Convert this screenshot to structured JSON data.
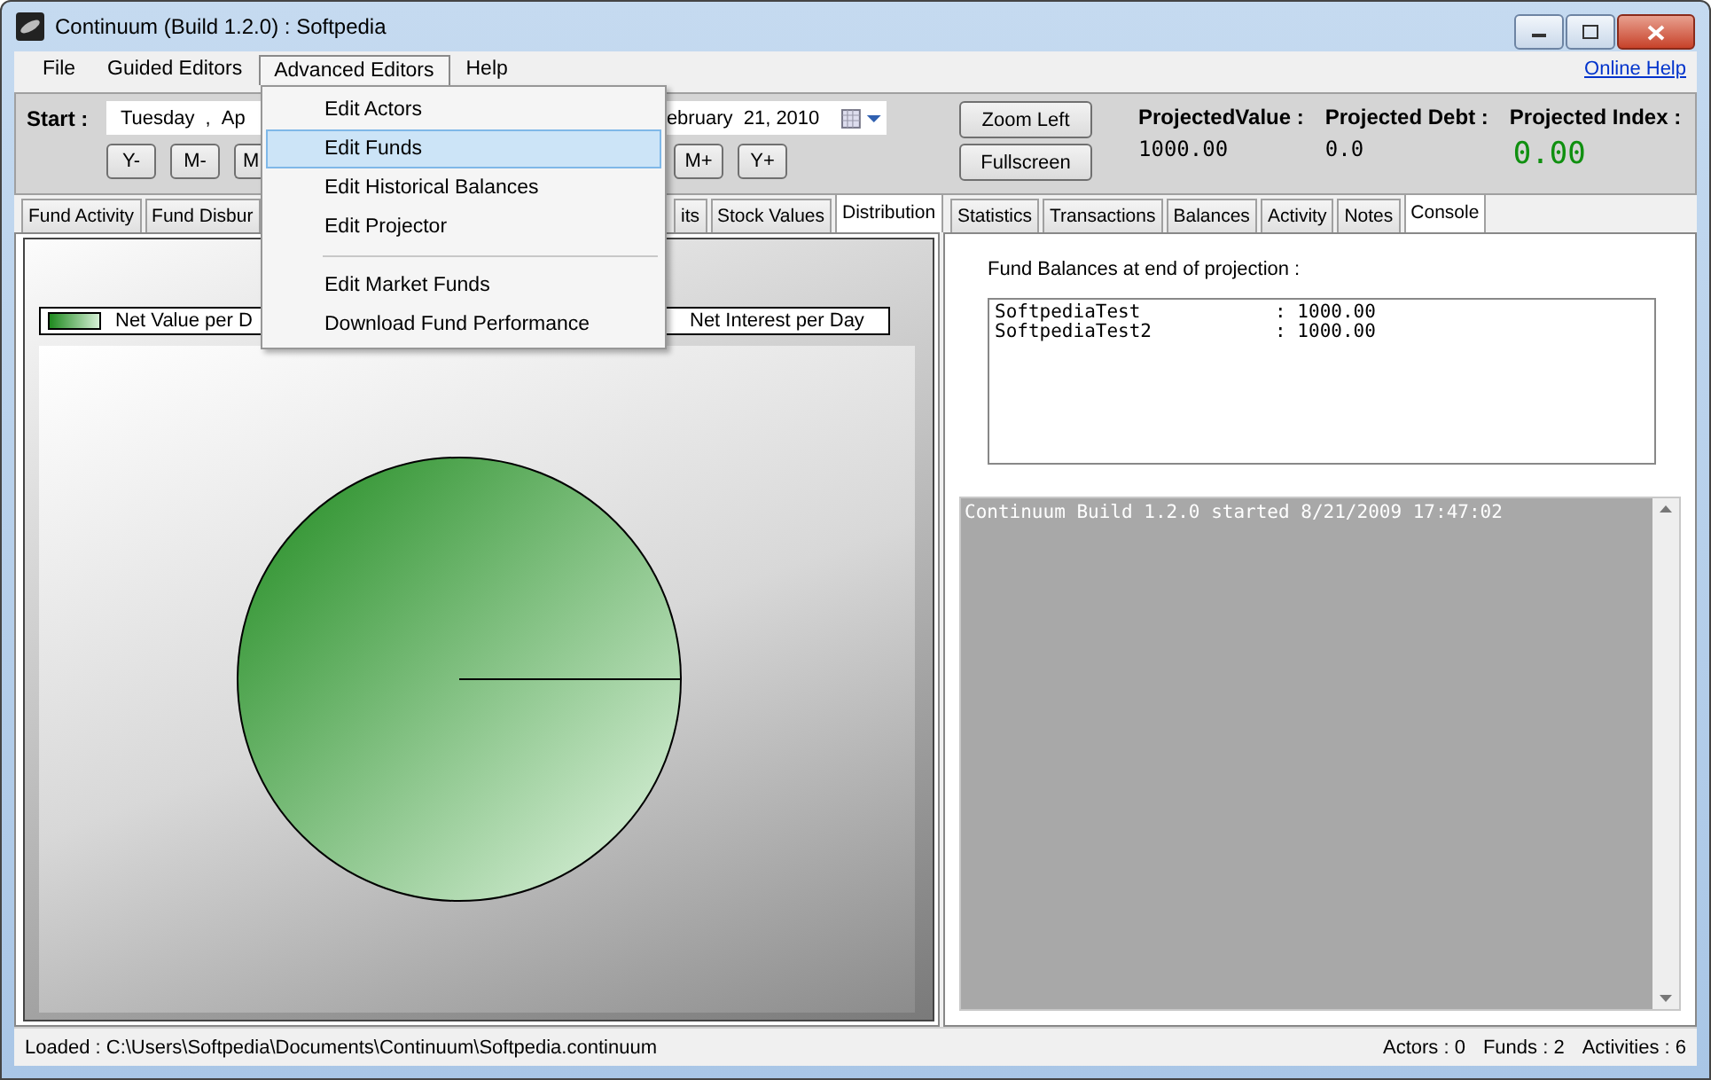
{
  "window": {
    "title": "Continuum (Build 1.2.0) : Softpedia"
  },
  "menu": {
    "items": [
      {
        "label": "File",
        "selected": false
      },
      {
        "label": "Guided Editors",
        "selected": false
      },
      {
        "label": "Advanced Editors",
        "selected": true
      },
      {
        "label": "Help",
        "selected": false
      }
    ],
    "link": "Online Help"
  },
  "dropdown": {
    "items": [
      {
        "kind": "item",
        "label": "Edit Actors",
        "selected": false
      },
      {
        "kind": "item",
        "label": "Edit Funds",
        "selected": true
      },
      {
        "kind": "item",
        "label": "Edit Historical Balances",
        "selected": false
      },
      {
        "kind": "item",
        "label": "Edit Projector",
        "selected": false
      },
      {
        "kind": "separator"
      },
      {
        "kind": "item",
        "label": "Edit Market Funds",
        "selected": false
      },
      {
        "kind": "item",
        "label": "Download Fund Performance",
        "selected": false
      }
    ]
  },
  "toolbar": {
    "start_label": "Start :",
    "date_parts": [
      "Tuesday",
      ",",
      "Ap"
    ],
    "date_end": "ebruary  21, 2010",
    "step_buttons_left": [
      "Y-",
      "M-",
      "M"
    ],
    "step_buttons_right": [
      "M+",
      "Y+"
    ],
    "buttons": [
      "Zoom Left",
      "Fullscreen"
    ],
    "stats": [
      {
        "label": "ProjectedValue :",
        "value": "1000.00",
        "kind": "plain"
      },
      {
        "label": "Projected Debt :",
        "value": "0.0",
        "kind": "plain"
      },
      {
        "label": "Projected Index :",
        "value": "0.00",
        "kind": "highlight"
      }
    ]
  },
  "left_panel": {
    "tabs_left": [
      {
        "label": "Fund Activity",
        "selected": false
      },
      {
        "label": "Fund Disbur",
        "selected": false
      }
    ],
    "tabs_right": [
      {
        "label": "its",
        "selected": false
      },
      {
        "label": "Stock Values",
        "selected": false
      },
      {
        "label": "Distribution",
        "selected": true
      }
    ],
    "legend": [
      "Net Value per D",
      "Net Interest per Day"
    ]
  },
  "right_panel": {
    "tabs": [
      {
        "label": "Statistics",
        "selected": false
      },
      {
        "label": "Transactions",
        "selected": false
      },
      {
        "label": "Balances",
        "selected": false
      },
      {
        "label": "Activity",
        "selected": false
      },
      {
        "label": "Notes",
        "selected": false
      },
      {
        "label": "Console",
        "selected": true
      }
    ],
    "balances_label": "Fund Balances at end of projection :",
    "balances": [
      "SoftpediaTest            : 1000.00",
      "SoftpediaTest2           : 1000.00"
    ],
    "console": [
      "Continuum Build 1.2.0 started 8/21/2009 17:47:02"
    ]
  },
  "status_bar": {
    "path": "Loaded : C:\\Users\\Softpedia\\Documents\\Continuum\\Softpedia.continuum",
    "counts": [
      "Actors : 0",
      "Funds : 2",
      "Activities : 6"
    ]
  }
}
